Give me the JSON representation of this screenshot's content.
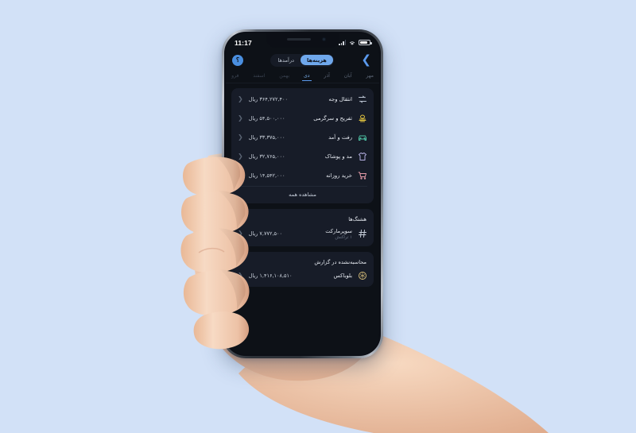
{
  "canvas": {
    "background": "#d2e1f7"
  },
  "statusbar": {
    "time": "11:17",
    "signal_icon": "cellular-signal-icon",
    "wifi_icon": "wifi-icon",
    "battery_icon": "battery-icon"
  },
  "topbar": {
    "help_icon": "help-circle-icon",
    "help_glyph": "؟",
    "forward_icon": "chevron-forward-icon",
    "forward_glyph": "❯",
    "segments": [
      {
        "label": "هزینه‌ها",
        "active": true
      },
      {
        "label": "درآمدها",
        "active": false
      }
    ]
  },
  "months": [
    {
      "label": "مهر",
      "active": false,
      "dim": false
    },
    {
      "label": "آبان",
      "active": false,
      "dim": false
    },
    {
      "label": "آذر",
      "active": false,
      "dim": false
    },
    {
      "label": "دی",
      "active": true,
      "dim": false
    },
    {
      "label": "بهمن",
      "active": false,
      "dim": true
    },
    {
      "label": "اسفند",
      "active": false,
      "dim": true
    },
    {
      "label": "فرو",
      "active": false,
      "dim": true
    }
  ],
  "categories": {
    "rows": [
      {
        "label": "انتقال وجه",
        "amount": "۳۶۴,۲۷۲,۴۰۰ ریال",
        "icon": "transfer-arrows-icon",
        "color": "#b9c2d0"
      },
      {
        "label": "تفریح و سرگرمی",
        "amount": "۵۴,۵۰۰,۰۰۰ ریال",
        "icon": "entertainment-icon",
        "color": "#e3c53f"
      },
      {
        "label": "رفت و آمد",
        "amount": "۳۳,۳۷۵,۰۰۰ ریال",
        "icon": "car-transport-icon",
        "color": "#4cbfa2"
      },
      {
        "label": "مد و پوشاک",
        "amount": "۳۲,۷۶۵,۰۰۰ ریال",
        "icon": "tshirt-clothing-icon",
        "color": "#b3aee0"
      },
      {
        "label": "خرید روزانه",
        "amount": "۱۴,۵۴۲,۰۰۰ ریال",
        "icon": "shopping-cart-icon",
        "color": "#e59aa8"
      }
    ],
    "see_all": "مشاهده همه"
  },
  "hashtags": {
    "title": "هشتگ‌ها",
    "rows": [
      {
        "label": "سوپرمارکت",
        "sub": "۱ تراکنش",
        "amount": "۷,۷۷۲,۵۰۰ ریال",
        "icon": "hashtag-icon",
        "color": "#c7cfdb"
      }
    ]
  },
  "excluded": {
    "title": "محاسبه‌نشده در گزارش",
    "rows": [
      {
        "label": "بلوباکس",
        "amount": "۱,۴۱۶,۱۰۸,۵۱۰ ریال",
        "icon": "blubox-circle-icon",
        "color": "#d9c07a"
      }
    ]
  },
  "chevron_glyph": "❮"
}
